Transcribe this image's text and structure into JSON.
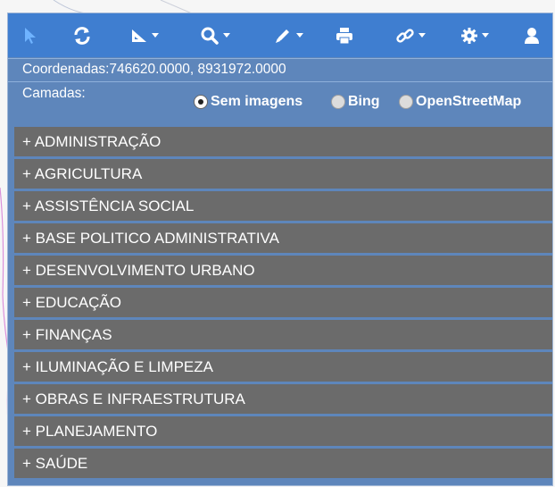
{
  "toolbar": {
    "tools": [
      {
        "name": "select-tool",
        "icon": "cursor-arrow-icon",
        "dropdown": false
      },
      {
        "name": "refresh-tool",
        "icon": "refresh-icon",
        "dropdown": false
      },
      {
        "name": "measure-tool",
        "icon": "ruler-triangle-icon",
        "dropdown": true
      },
      {
        "name": "zoom-tool",
        "icon": "magnifier-icon",
        "dropdown": true
      },
      {
        "name": "draw-tool",
        "icon": "pencil-icon",
        "dropdown": true
      },
      {
        "name": "print-tool",
        "icon": "printer-icon",
        "dropdown": false
      },
      {
        "name": "link-tool",
        "icon": "link-icon",
        "dropdown": true
      },
      {
        "name": "settings-tool",
        "icon": "gear-icon",
        "dropdown": true
      },
      {
        "name": "user-tool",
        "icon": "user-icon",
        "dropdown": false
      }
    ],
    "bg_color": "#3f7ed0",
    "active_icon_color": "#6fb3ff"
  },
  "coords": {
    "text": "Coordenadas:746620.0000, 8931972.0000"
  },
  "layers": {
    "label": "Camadas:",
    "options": [
      {
        "label": "Sem imagens",
        "selected": true
      },
      {
        "label": "Bing",
        "selected": false
      },
      {
        "label": "OpenStreetMap",
        "selected": false
      }
    ]
  },
  "categories": [
    "+ ADMINISTRAÇÃO",
    "+ AGRICULTURA",
    "+ ASSISTÊNCIA SOCIAL",
    "+ BASE POLITICO ADMINISTRATIVA",
    "+ DESENVOLVIMENTO URBANO",
    "+ EDUCAÇÃO",
    "+ FINANÇAS",
    "+ ILUMINAÇÃO E LIMPEZA",
    "+ OBRAS E INFRAESTRUTURA",
    "+ PLANEJAMENTO",
    "+ SAÚDE"
  ],
  "colors": {
    "panel": "#5e86bb",
    "category_bg": "#6b6b6b",
    "text": "#ffffff"
  }
}
